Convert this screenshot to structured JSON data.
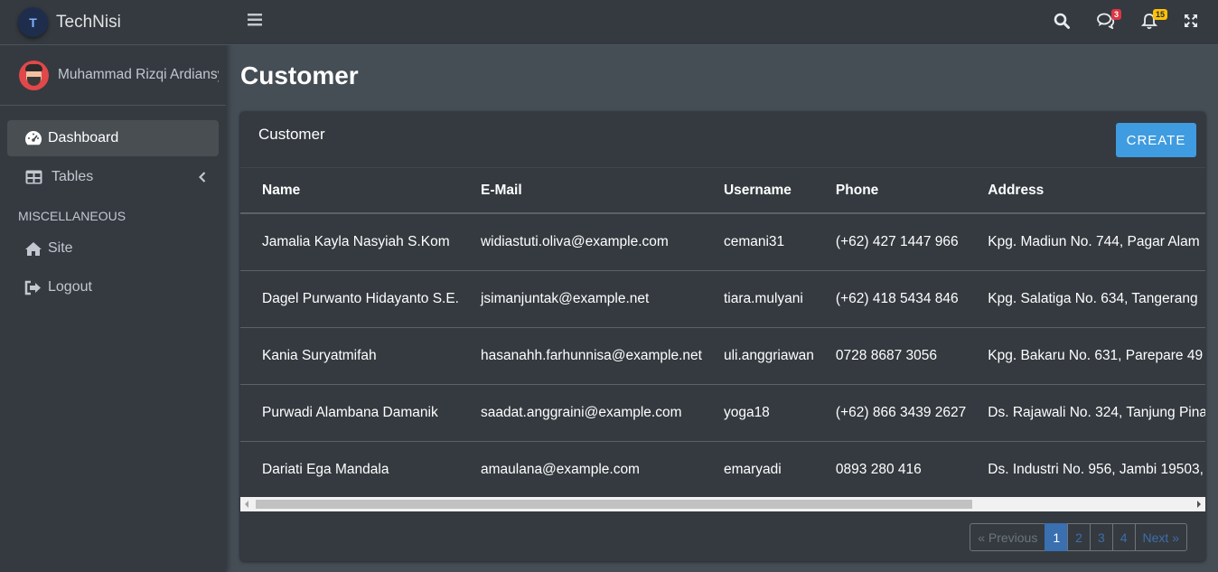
{
  "brand": {
    "name": "TechNisi",
    "logo_text": "T"
  },
  "user": {
    "name": "Muhammad Rizqi Ardiansyah"
  },
  "sidebar": {
    "items": [
      {
        "label": "Dashboard",
        "icon": "tachometer-icon",
        "active": true
      },
      {
        "label": "Tables",
        "icon": "table-icon",
        "active": false
      }
    ],
    "section_header": "MISCELLANEOUS",
    "misc_items": [
      {
        "label": "Site",
        "icon": "home-icon"
      },
      {
        "label": "Logout",
        "icon": "sign-out-icon"
      }
    ]
  },
  "topbar": {
    "messages_badge": "3",
    "notifications_badge": "15"
  },
  "page": {
    "title": "Customer"
  },
  "card": {
    "title": "Customer",
    "create_label": "CREATE"
  },
  "table": {
    "headers": [
      "Name",
      "E-Mail",
      "Username",
      "Phone",
      "Address"
    ],
    "rows": [
      [
        "Jamalia Kayla Nasyiah S.Kom",
        "widiastuti.oliva@example.com",
        "cemani31",
        "(+62) 427 1447 966",
        "Kpg. Madiun No. 744, Pagar Alam"
      ],
      [
        "Dagel Purwanto Hidayanto S.E.",
        "jsimanjuntak@example.net",
        "tiara.mulyani",
        "(+62) 418 5434 846",
        "Kpg. Salatiga No. 634, Tangerang"
      ],
      [
        "Kania Suryatmifah",
        "hasanahh.farhunnisa@example.net",
        "uli.anggriawan",
        "0728 8687 3056",
        "Kpg. Bakaru No. 631, Parepare 49"
      ],
      [
        "Purwadi Alambana Damanik",
        "saadat.anggraini@example.com",
        "yoga18",
        "(+62) 866 3439 2627",
        "Ds. Rajawali No. 324, Tanjung Pina"
      ],
      [
        "Dariati Ega Mandala",
        "amaulana@example.com",
        "emaryadi",
        "0893 280 416",
        "Ds. Industri No. 956, Jambi 19503,"
      ]
    ]
  },
  "pagination": {
    "previous": "« Previous",
    "pages": [
      "1",
      "2",
      "3",
      "4"
    ],
    "next": "Next »"
  },
  "colors": {
    "sidebar_bg": "#343a40",
    "content_bg": "#454d55",
    "primary_button": "#3f9ce0",
    "active_page": "#3a6fb0"
  }
}
